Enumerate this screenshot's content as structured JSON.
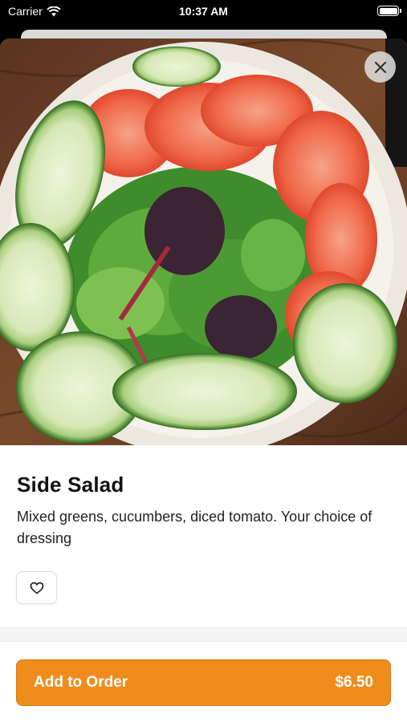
{
  "status_bar": {
    "carrier": "Carrier",
    "time": "10:37 AM",
    "wifi_icon": "wifi-icon",
    "battery_icon": "battery-icon"
  },
  "item": {
    "title": "Side Salad",
    "description": "Mixed greens, cucumbers, diced tomato. Your choice of dressing",
    "image": "side-salad-photo"
  },
  "actions": {
    "close_icon": "close-icon",
    "favorite_icon": "heart-icon",
    "add_label": "Add to Order",
    "price": "$6.50"
  },
  "colors": {
    "accent": "#f08c1c",
    "text": "#111111"
  }
}
